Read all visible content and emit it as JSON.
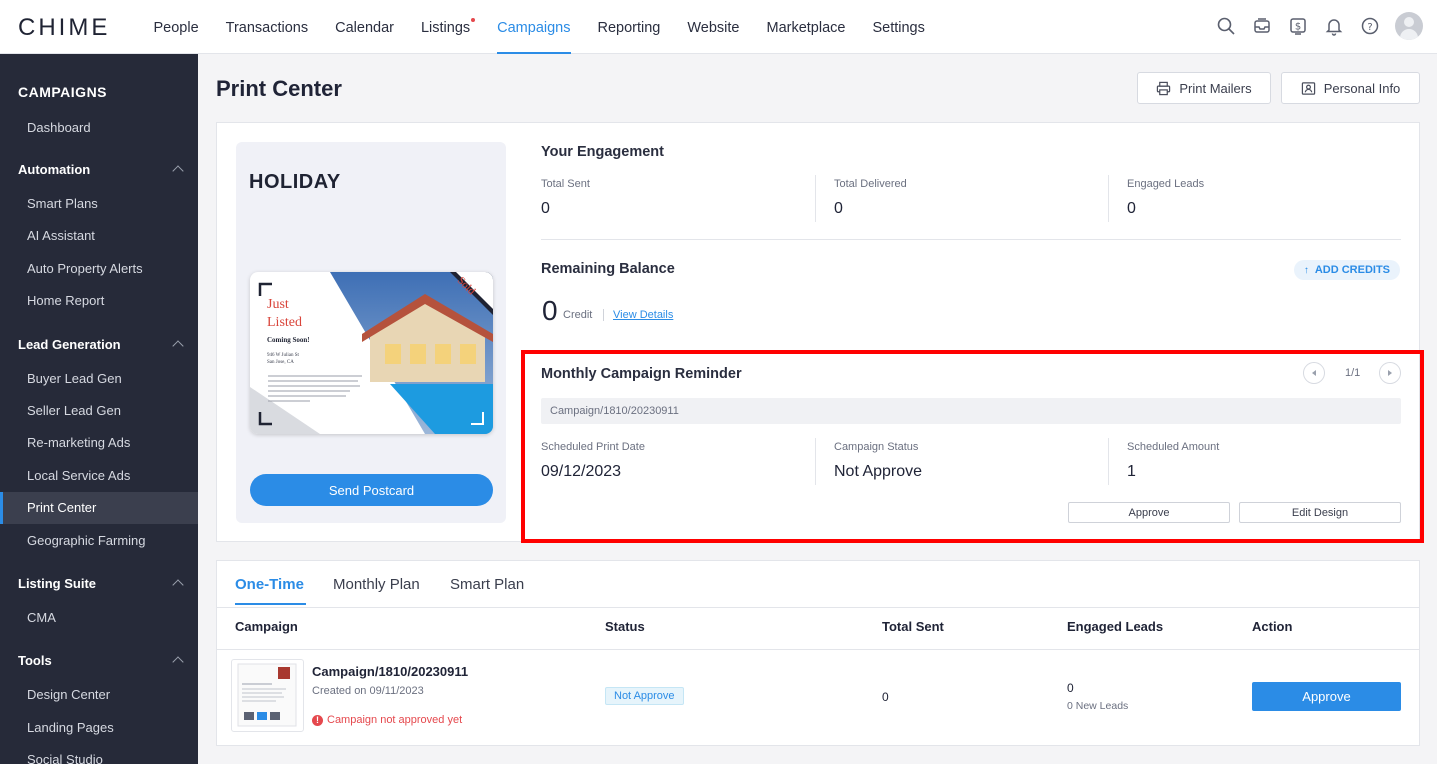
{
  "app": {
    "logo": "CHIME"
  },
  "nav": {
    "items": [
      {
        "label": "People"
      },
      {
        "label": "Transactions"
      },
      {
        "label": "Calendar"
      },
      {
        "label": "Listings"
      },
      {
        "label": "Campaigns"
      },
      {
        "label": "Reporting"
      },
      {
        "label": "Website"
      },
      {
        "label": "Marketplace"
      },
      {
        "label": "Settings"
      }
    ],
    "active": "Campaigns",
    "icons": [
      "search-icon",
      "inbox-icon",
      "billing-icon",
      "bell-icon",
      "help-icon",
      "avatar"
    ]
  },
  "sidebar": {
    "title": "CAMPAIGNS",
    "dashboard": "Dashboard",
    "automation": {
      "label": "Automation",
      "items": [
        "Smart Plans",
        "AI Assistant",
        "Auto Property Alerts",
        "Home Report"
      ]
    },
    "lead_generation": {
      "label": "Lead Generation",
      "items": [
        "Buyer Lead Gen",
        "Seller Lead Gen",
        "Re-marketing Ads",
        "Local Service Ads",
        "Print Center",
        "Geographic Farming"
      ]
    },
    "listing_suite": {
      "label": "Listing Suite",
      "items": [
        "CMA"
      ]
    },
    "tools": {
      "label": "Tools",
      "items": [
        "Design Center",
        "Landing Pages",
        "Social Studio"
      ]
    },
    "active": "Print Center"
  },
  "page": {
    "title": "Print Center",
    "print_mailers_label": "Print Mailers",
    "personal_info_label": "Personal Info"
  },
  "promo": {
    "title": "HOLIDAY",
    "card": {
      "just": "Just",
      "listed": "Listed",
      "sold": "Sold",
      "coming_soon": "Coming Soon!",
      "address1": "946 W Julian St",
      "address2": "San Jose, CA"
    },
    "send_label": "Send Postcard"
  },
  "engagement": {
    "title": "Your Engagement",
    "stats": [
      {
        "label": "Total Sent",
        "value": "0"
      },
      {
        "label": "Total Delivered",
        "value": "0"
      },
      {
        "label": "Engaged Leads",
        "value": "0"
      }
    ]
  },
  "balance": {
    "title": "Remaining Balance",
    "add_credits": "ADD CREDITS",
    "value": "0",
    "unit": "Credit",
    "view_details": "View Details"
  },
  "reminder": {
    "title": "Monthly Campaign Reminder",
    "pager": "1/1",
    "campaign": "Campaign/1810/20230911",
    "fields": [
      {
        "label": "Scheduled Print Date",
        "value": "09/12/2023"
      },
      {
        "label": "Campaign Status",
        "value": "Not Approve"
      },
      {
        "label": "Scheduled Amount",
        "value": "1"
      }
    ],
    "approve_label": "Approve",
    "edit_label": "Edit Design"
  },
  "table": {
    "tabs": [
      "One-Time",
      "Monthly Plan",
      "Smart Plan"
    ],
    "active_tab": "One-Time",
    "columns": [
      "Campaign",
      "Status",
      "Total Sent",
      "Engaged Leads",
      "Action"
    ],
    "rows": [
      {
        "name": "Campaign/1810/20230911",
        "created": "Created on 09/11/2023",
        "warning": "Campaign not approved yet",
        "status": "Not Approve",
        "total_sent": "0",
        "engaged": "0",
        "new_leads": "0 New Leads",
        "action": "Approve"
      }
    ]
  },
  "colors": {
    "accent": "#2b8ce6",
    "sidebar": "#262a39",
    "highlight": "#ff0000",
    "error": "#e5484d"
  }
}
